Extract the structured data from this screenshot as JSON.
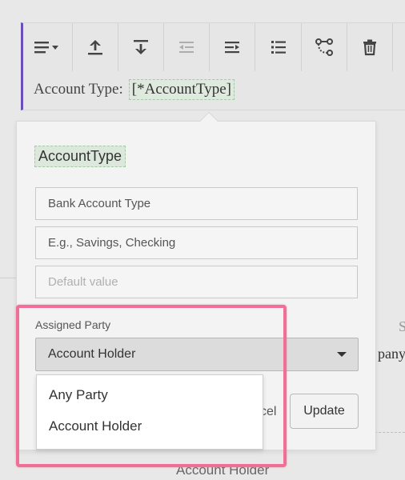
{
  "block": {
    "label": "Account Type:",
    "token": "[*AccountType]",
    "accent_color": "#6b4fb8"
  },
  "toolbar": {
    "buttons": [
      {
        "name": "align",
        "icon": "align-left-dropdown-icon"
      },
      {
        "name": "insert-above",
        "icon": "arrow-up-bar-icon"
      },
      {
        "name": "insert-below",
        "icon": "arrow-down-bar-icon"
      },
      {
        "name": "outdent",
        "icon": "outdent-icon",
        "disabled": true
      },
      {
        "name": "indent",
        "icon": "indent-icon"
      },
      {
        "name": "list",
        "icon": "bullet-list-icon"
      },
      {
        "name": "branch",
        "icon": "branch-icon"
      },
      {
        "name": "delete",
        "icon": "trash-icon"
      }
    ]
  },
  "popover": {
    "variable_name": "AccountType",
    "fields": {
      "label_value": "Bank Account Type",
      "hint_value": "E.g., Savings, Checking",
      "default_placeholder": "Default value"
    },
    "assigned_party": {
      "label": "Assigned Party",
      "selected": "Account Holder",
      "options": [
        "Any Party",
        "Account Holder"
      ]
    },
    "cancel_fragment": "cel",
    "update_label": "Update"
  },
  "background": {
    "partial_s": "S",
    "partial_pany": "pany",
    "account_holder": "Account Holder"
  },
  "highlight_color": "#ef6f96"
}
